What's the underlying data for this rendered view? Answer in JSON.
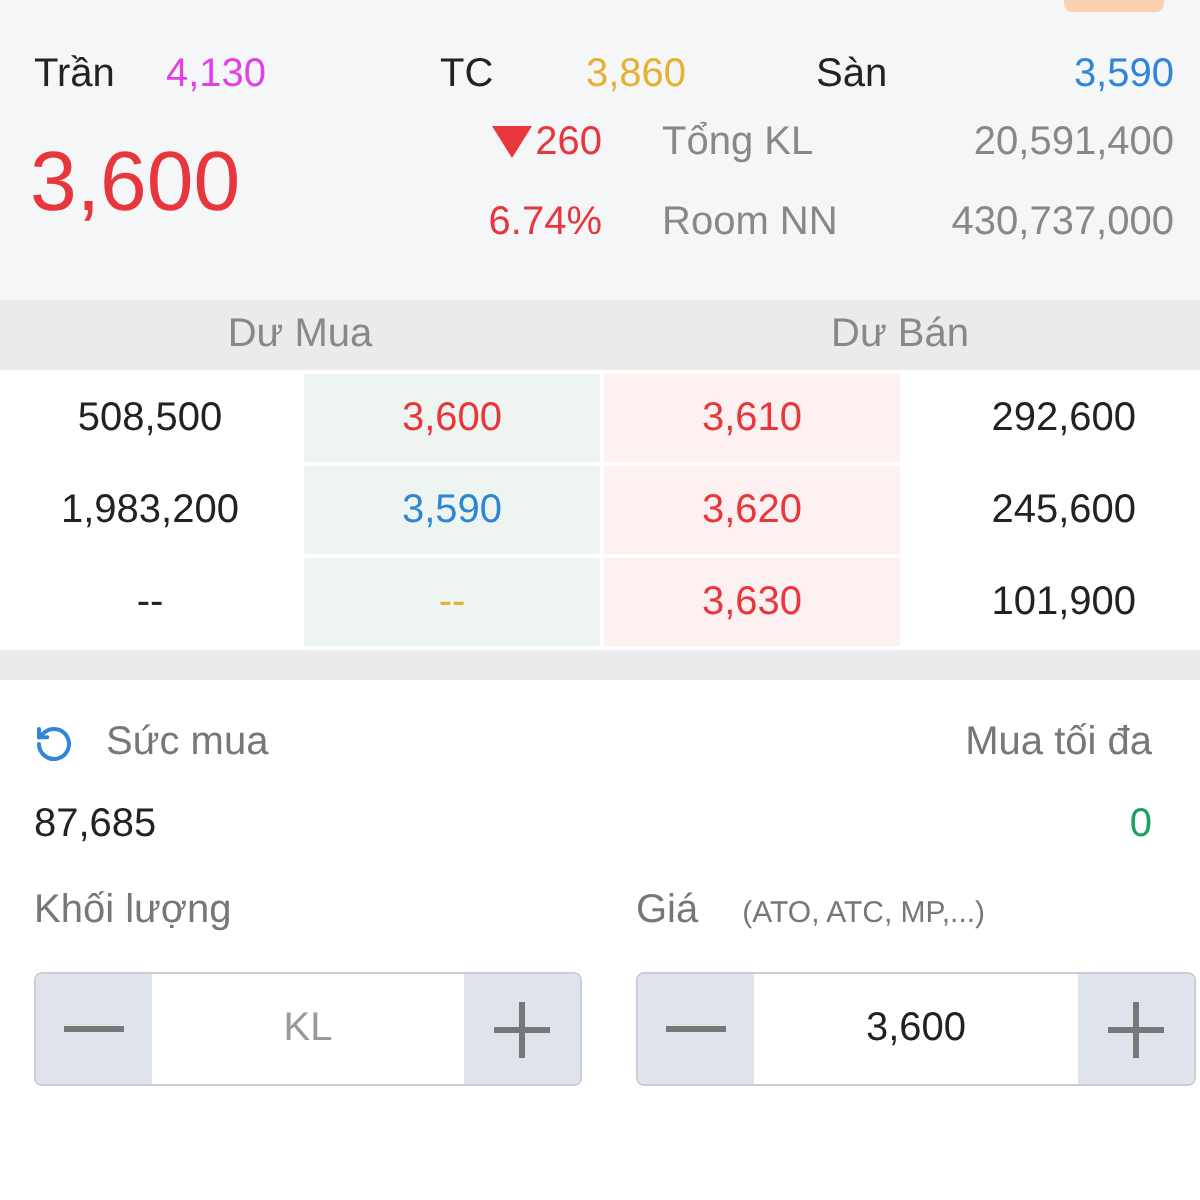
{
  "reference_prices": [
    {
      "label": "Trần",
      "value": "4,130",
      "color": "#e040e8"
    },
    {
      "label": "TC",
      "value": "3,860",
      "color": "#e8b030"
    },
    {
      "label": "Sàn",
      "value": "3,590",
      "color": "#2f86d8"
    }
  ],
  "last_price": "3,600",
  "change": {
    "falling": true,
    "value": "260",
    "percent": "6.74%"
  },
  "stats": [
    {
      "label": "Tổng KL",
      "value": "20,591,400"
    },
    {
      "label": "Room NN",
      "value": "430,737,000"
    }
  ],
  "order_book": {
    "headers": [
      "Dư Mua",
      "Dư Bán"
    ],
    "rows": [
      {
        "bid_volume": "508,500",
        "bid_price": {
          "text": "3,600",
          "color": "#e8363d"
        },
        "ask_price": {
          "text": "3,610",
          "color": "#e8363d"
        },
        "ask_volume": "292,600"
      },
      {
        "bid_volume": "1,983,200",
        "bid_price": {
          "text": "3,590",
          "color": "#2f86d8"
        },
        "ask_price": {
          "text": "3,620",
          "color": "#e8363d"
        },
        "ask_volume": "245,600"
      },
      {
        "bid_volume": "--",
        "bid_price": {
          "text": "--",
          "color": "#e8b030"
        },
        "ask_price": {
          "text": "3,630",
          "color": "#e8363d"
        },
        "ask_volume": "101,900"
      }
    ]
  },
  "buying_power": {
    "label": "Sức mua",
    "value": "87,685"
  },
  "max_buy": {
    "label": "Mua tối đa",
    "value": "0"
  },
  "quantity": {
    "label": "Khối lượng",
    "placeholder": "KL"
  },
  "price": {
    "label": "Giá",
    "hint": "(ATO, ATC, MP,...)",
    "value": "3,600"
  }
}
